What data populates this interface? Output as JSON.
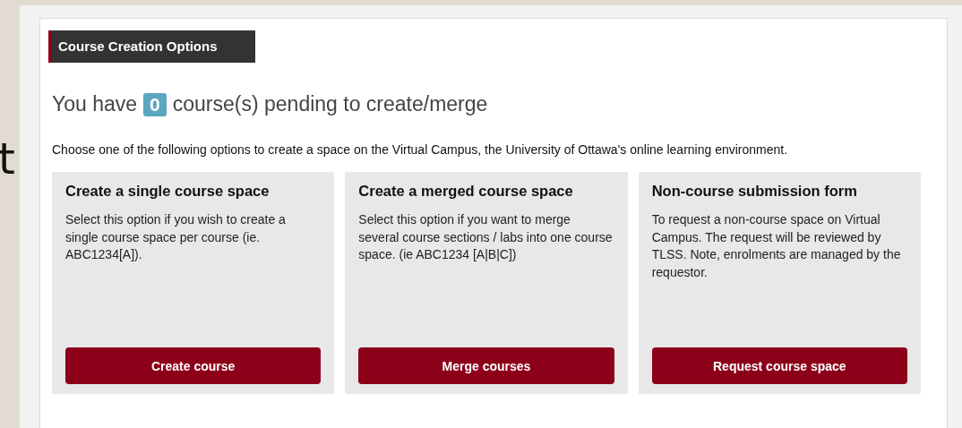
{
  "background_text": "t",
  "section_title": "Course Creation Options",
  "pending": {
    "prefix": "You have",
    "count": "0",
    "suffix": "course(s) pending to create/merge"
  },
  "intro": "Choose one of the following options to create a space on the Virtual Campus, the University of Ottawa's online learning environment.",
  "options": [
    {
      "title": "Create a single course space",
      "description": "Select this option if you wish to create a single course space per course (ie. ABC1234[A]).",
      "button": "Create course"
    },
    {
      "title": "Create a merged course space",
      "description": "Select this option if you want to merge several course sections / labs into one course space. (ie ABC1234 [A|B|C])",
      "button": "Merge courses"
    },
    {
      "title": "Non-course submission form",
      "description": "To request a non-course space on Virtual Campus. The request will be reviewed by TLSS. Note, enrolments are managed by the requestor.",
      "button": "Request course space"
    }
  ]
}
